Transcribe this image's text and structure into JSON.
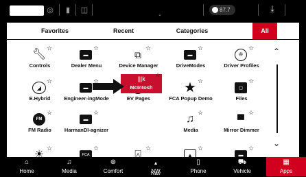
{
  "status": {
    "radio_text": "87.7",
    "icons": [
      "camera-icon",
      "phone-icon",
      "media-icon",
      "signal-icon",
      "download-icon"
    ]
  },
  "tabs": [
    {
      "label": "Favorites"
    },
    {
      "label": "Recent"
    },
    {
      "label": "Categories"
    },
    {
      "label": "All"
    }
  ],
  "apps": [
    {
      "label": "Controls",
      "icon": "wrench-icon"
    },
    {
      "label": "Dealer Menu",
      "icon": "car-icon"
    },
    {
      "label": "Device Manager",
      "icon": "device-manager-icon"
    },
    {
      "label": "DriveModes",
      "icon": "car-icon"
    },
    {
      "label": "Driver Profiles",
      "icon": "profile-icon"
    },
    {
      "label": "E.Hybrid",
      "icon": "hybrid-icon"
    },
    {
      "label": "Engineer-ingMode",
      "icon": "car-icon"
    },
    {
      "label": "EV Pages",
      "icon": "ev-pages-icon"
    },
    {
      "label": "FCA Popup Demo",
      "icon": "star-icon"
    },
    {
      "label": "Files",
      "icon": "folder-icon"
    },
    {
      "label": "FM Radio",
      "icon": "fm-icon"
    },
    {
      "label": "HarmanDI-agnizer",
      "icon": "car-icon"
    },
    {
      "label": "McIntosh",
      "icon": "mcintosh-icon"
    },
    {
      "label": "Media",
      "icon": "music-icon"
    },
    {
      "label": "Mirror Dimmer",
      "icon": "mirror-icon"
    }
  ],
  "partial_row": [
    {
      "icon": "weather-icon"
    },
    {
      "icon": "fca-icon",
      "text": "FCA"
    },
    {
      "icon": "bell-icon"
    },
    {
      "icon": "car-icon"
    },
    {
      "icon": "car-icon"
    }
  ],
  "nav": [
    {
      "label": "Home",
      "icon": "home-icon"
    },
    {
      "label": "Media",
      "icon": "music-icon"
    },
    {
      "label": "Comfort",
      "icon": "comfort-icon"
    },
    {
      "label": "Nav",
      "icon": "compass-icon",
      "heading": "NW"
    },
    {
      "label": "Phone",
      "icon": "phone-icon"
    },
    {
      "label": "Vehicle",
      "icon": "vehicle-icon"
    },
    {
      "label": "Apps",
      "icon": "apps-icon"
    }
  ],
  "colors": {
    "accent": "#d2001f",
    "background": "#000000",
    "panel": "#ffffff"
  }
}
